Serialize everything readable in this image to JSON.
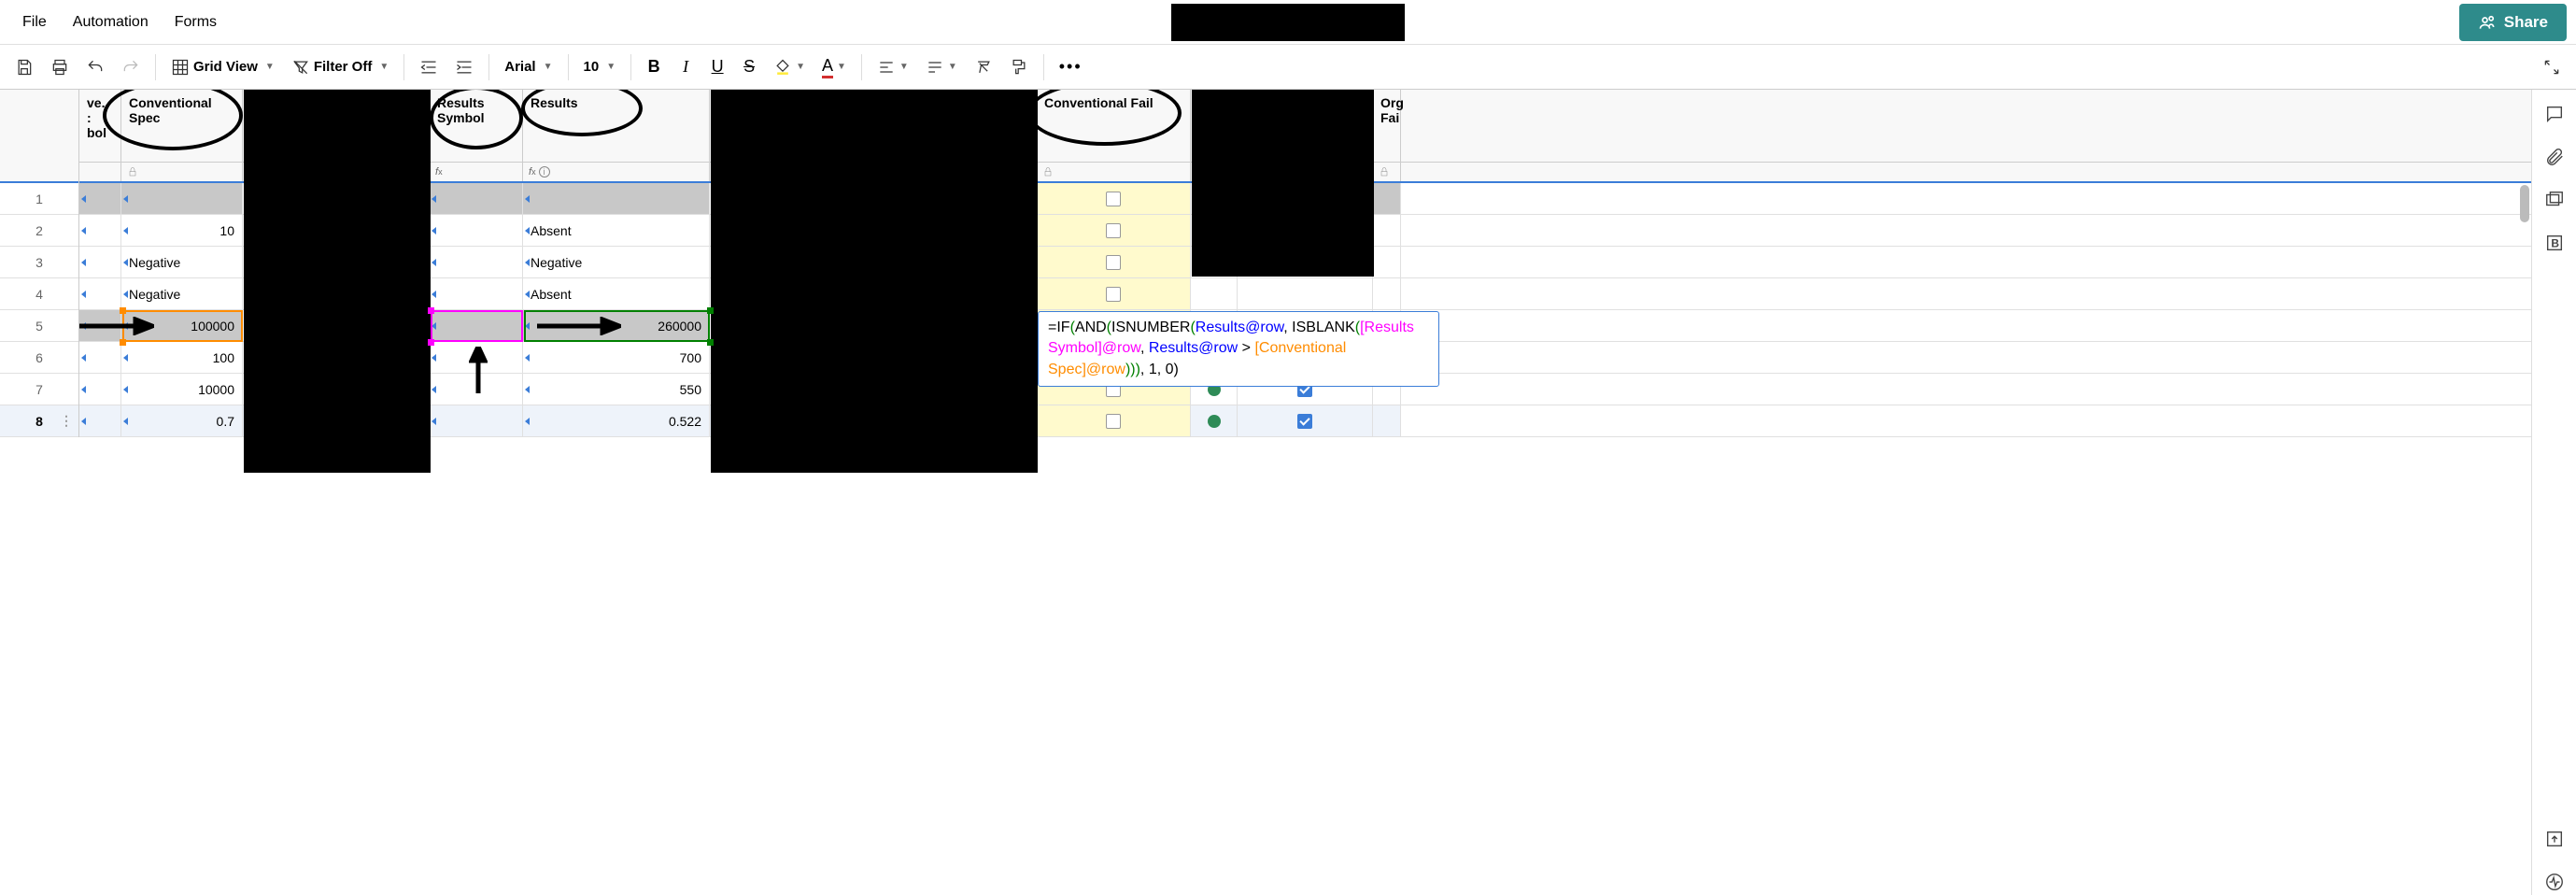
{
  "menu": {
    "file": "File",
    "automation": "Automation",
    "forms": "Forms",
    "share": "Share"
  },
  "toolbar": {
    "grid_view": "Grid View",
    "filter_off": "Filter Off",
    "font": "Arial",
    "font_size": "10"
  },
  "columns": {
    "partial_left": "ve.\n:\nbol",
    "conventional_spec": "Conventional Spec",
    "results_symbol": "Results Symbol",
    "results": "Results",
    "conventional_fail": "Conventional Fail",
    "organic_fail": "Org\nFai"
  },
  "rows": [
    {
      "num": "1",
      "conv_spec": "",
      "results": ""
    },
    {
      "num": "2",
      "conv_spec": "10",
      "results": "Absent"
    },
    {
      "num": "3",
      "conv_spec": "Negative",
      "results": "Negative"
    },
    {
      "num": "4",
      "conv_spec": "Negative",
      "results": "Absent"
    },
    {
      "num": "5",
      "conv_spec": "100000",
      "results": "260000"
    },
    {
      "num": "6",
      "conv_spec": "100",
      "results": "700"
    },
    {
      "num": "7",
      "conv_spec": "10000",
      "results": "550"
    },
    {
      "num": "8",
      "conv_spec": "0.7",
      "results": "0.522"
    }
  ],
  "formula": {
    "prefix": "=IF",
    "and": "AND",
    "isnumber": "ISNUMBER",
    "results_ref": "Results@row",
    "isblank": "ISBLANK",
    "results_symbol_ref": "[Results Symbol]@row",
    "gt": ">",
    "conv_spec_ref": "[Conventional Spec]@row",
    "suffix": ", 1, 0)"
  }
}
